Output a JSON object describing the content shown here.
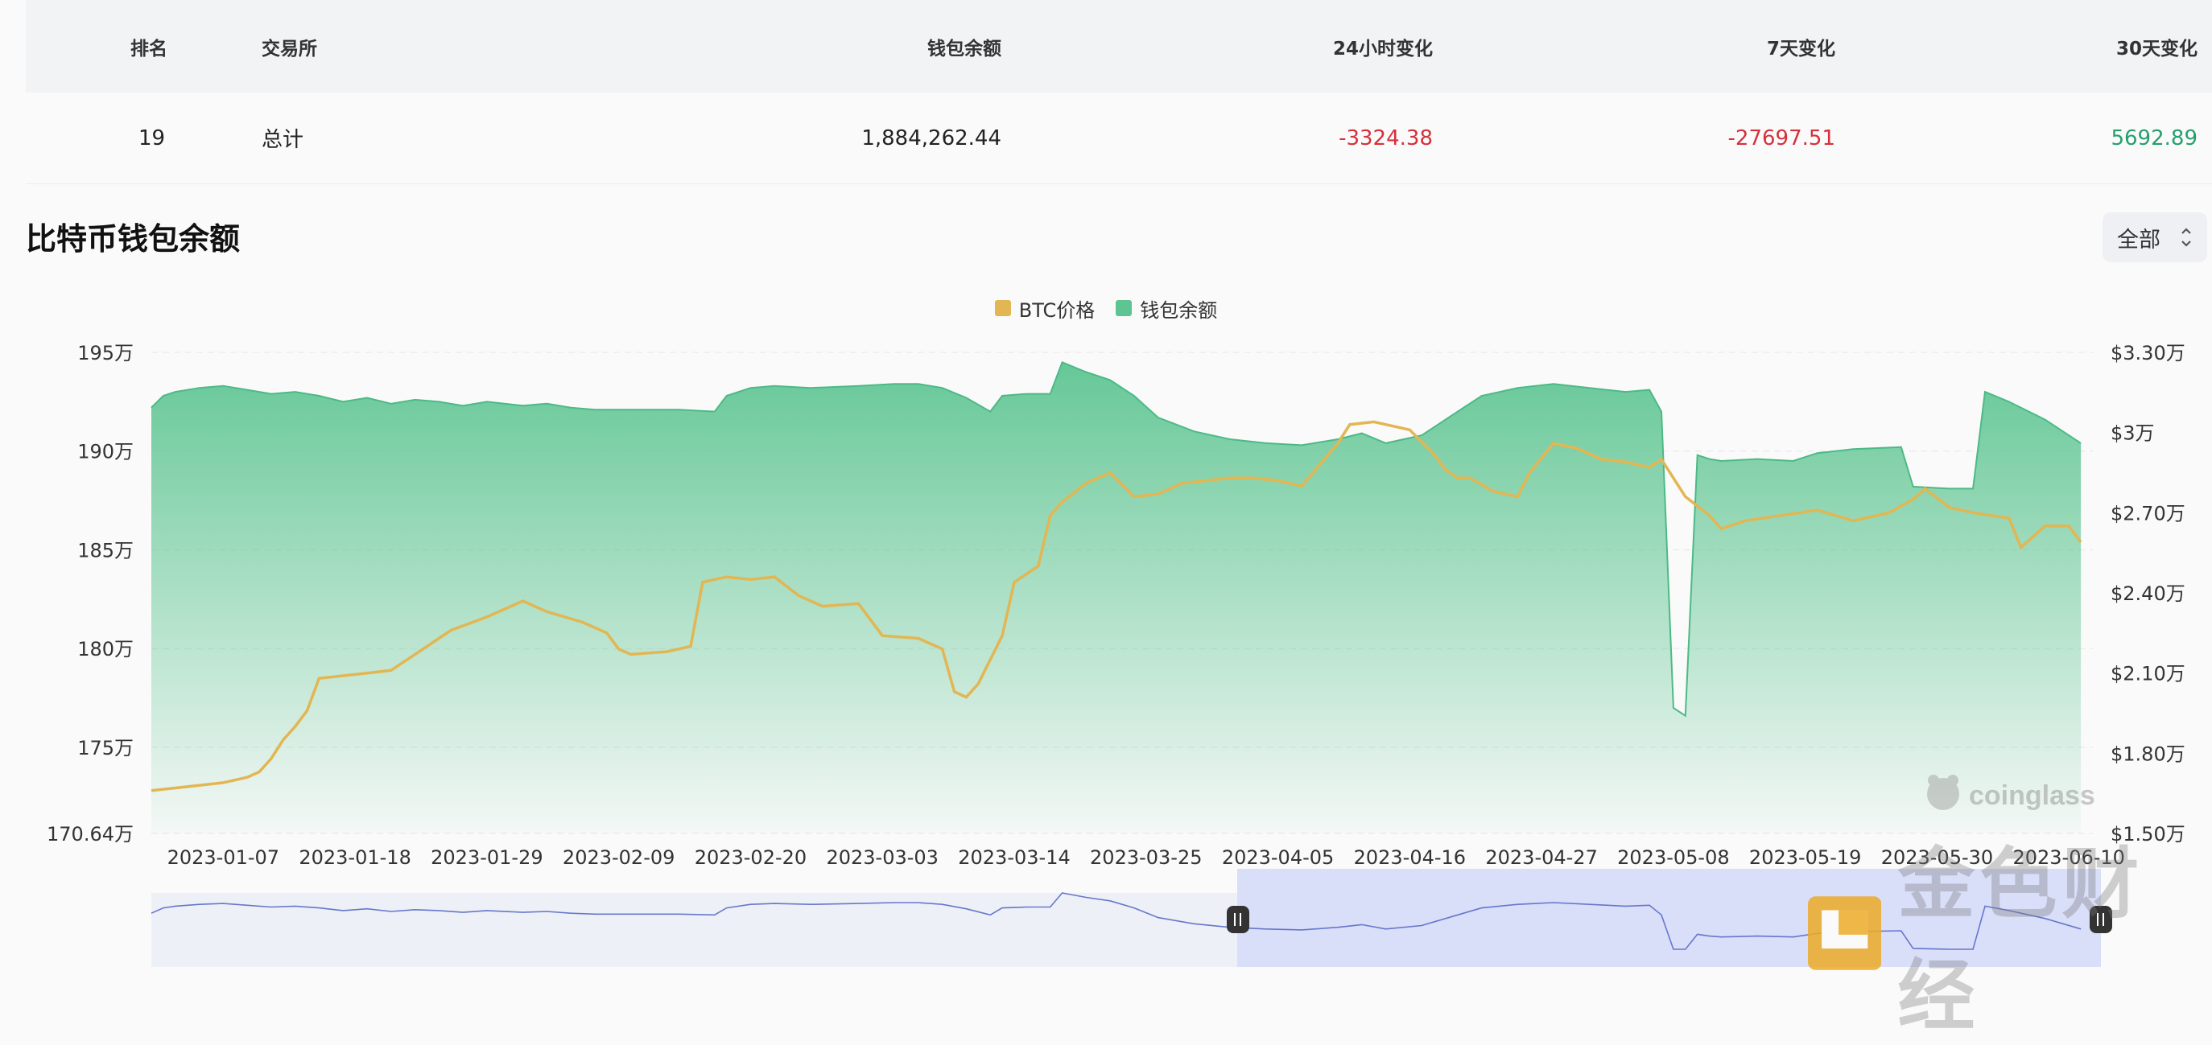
{
  "table": {
    "headers": {
      "rank": "排名",
      "exchange": "交易所",
      "balance": "钱包余额",
      "change_24h": "24小时变化",
      "change_7d": "7天变化",
      "change_30d": "30天变化"
    },
    "row": {
      "rank": "19",
      "exchange": "总计",
      "balance": "1,884,262.44",
      "change_24h": "-3324.38",
      "change_7d": "-27697.51",
      "change_30d": "5692.89"
    }
  },
  "section": {
    "title": "比特币钱包余额",
    "range_select": "全部"
  },
  "colors": {
    "price_line": "#e2b653",
    "balance_fill": "#5ec592",
    "balance_line": "#4cba85",
    "negative": "#d6303b",
    "positive": "#24a06b"
  },
  "watermarks": {
    "coinglass": "coinglass",
    "jinse": "金色财经"
  },
  "chart_data": {
    "type": "area",
    "legend": [
      "BTC价格",
      "钱包余额"
    ],
    "legend_position": "top-center",
    "grid": true,
    "y_left_ticks": [
      "195万",
      "190万",
      "185万",
      "180万",
      "175万",
      "170.64万"
    ],
    "y_right_ticks": [
      "$3.30万",
      "$3万",
      "$2.70万",
      "$2.40万",
      "$2.10万",
      "$1.80万",
      "$1.50万"
    ],
    "x_ticks": [
      "2023-01-07",
      "2023-01-18",
      "2023-01-29",
      "2023-02-09",
      "2023-02-20",
      "2023-03-03",
      "2023-03-14",
      "2023-03-25",
      "2023-04-05",
      "2023-04-16",
      "2023-04-27",
      "2023-05-08",
      "2023-05-19",
      "2023-05-30",
      "2023-06-10"
    ],
    "y_left_range": [
      1706400,
      1950000
    ],
    "y_right_range": [
      15000,
      33000
    ],
    "x_range": [
      "2023-01-01",
      "2023-06-12"
    ],
    "series": [
      {
        "name": "钱包余额",
        "axis": "left",
        "x": [
          "2023-01-01",
          "2023-01-02",
          "2023-01-03",
          "2023-01-05",
          "2023-01-07",
          "2023-01-09",
          "2023-01-11",
          "2023-01-13",
          "2023-01-15",
          "2023-01-17",
          "2023-01-19",
          "2023-01-21",
          "2023-01-23",
          "2023-01-25",
          "2023-01-27",
          "2023-01-29",
          "2023-02-01",
          "2023-02-03",
          "2023-02-05",
          "2023-02-07",
          "2023-02-10",
          "2023-02-14",
          "2023-02-17",
          "2023-02-18",
          "2023-02-20",
          "2023-02-22",
          "2023-02-25",
          "2023-03-01",
          "2023-03-04",
          "2023-03-06",
          "2023-03-08",
          "2023-03-10",
          "2023-03-12",
          "2023-03-13",
          "2023-03-15",
          "2023-03-17",
          "2023-03-18",
          "2023-03-20",
          "2023-03-22",
          "2023-03-24",
          "2023-03-26",
          "2023-03-29",
          "2023-04-01",
          "2023-04-04",
          "2023-04-07",
          "2023-04-10",
          "2023-04-12",
          "2023-04-14",
          "2023-04-17",
          "2023-04-20",
          "2023-04-22",
          "2023-04-25",
          "2023-04-28",
          "2023-05-01",
          "2023-05-04",
          "2023-05-06",
          "2023-05-07",
          "2023-05-08",
          "2023-05-09",
          "2023-05-10",
          "2023-05-11",
          "2023-05-12",
          "2023-05-15",
          "2023-05-18",
          "2023-05-20",
          "2023-05-23",
          "2023-05-27",
          "2023-05-28",
          "2023-05-31",
          "2023-06-02",
          "2023-06-03",
          "2023-06-05",
          "2023-06-08",
          "2023-06-11"
        ],
        "values": [
          1922000,
          1928000,
          1930000,
          1932000,
          1933000,
          1931000,
          1929000,
          1930000,
          1928000,
          1925000,
          1927000,
          1924000,
          1926000,
          1925000,
          1923000,
          1925000,
          1923000,
          1924000,
          1922000,
          1921000,
          1921000,
          1921000,
          1920000,
          1928000,
          1932000,
          1933000,
          1932000,
          1933000,
          1934000,
          1934000,
          1932000,
          1927000,
          1920000,
          1928000,
          1929000,
          1929000,
          1945000,
          1940000,
          1936000,
          1928000,
          1917000,
          1910000,
          1906000,
          1904000,
          1903000,
          1906000,
          1909000,
          1904000,
          1908000,
          1920000,
          1928000,
          1932000,
          1934000,
          1932000,
          1930000,
          1931000,
          1920000,
          1770000,
          1766000,
          1898000,
          1896000,
          1895000,
          1896000,
          1895000,
          1899000,
          1901000,
          1902000,
          1882000,
          1881000,
          1881000,
          1930000,
          1925000,
          1916000,
          1904000
        ]
      },
      {
        "name": "BTC价格",
        "axis": "right",
        "x": [
          "2023-01-01",
          "2023-01-03",
          "2023-01-05",
          "2023-01-07",
          "2023-01-09",
          "2023-01-10",
          "2023-01-11",
          "2023-01-12",
          "2023-01-13",
          "2023-01-14",
          "2023-01-15",
          "2023-01-17",
          "2023-01-19",
          "2023-01-21",
          "2023-01-23",
          "2023-01-26",
          "2023-01-29",
          "2023-02-01",
          "2023-02-03",
          "2023-02-06",
          "2023-02-08",
          "2023-02-09",
          "2023-02-10",
          "2023-02-13",
          "2023-02-15",
          "2023-02-16",
          "2023-02-18",
          "2023-02-20",
          "2023-02-22",
          "2023-02-24",
          "2023-02-26",
          "2023-03-01",
          "2023-03-03",
          "2023-03-06",
          "2023-03-08",
          "2023-03-09",
          "2023-03-10",
          "2023-03-11",
          "2023-03-13",
          "2023-03-14",
          "2023-03-16",
          "2023-03-17",
          "2023-03-18",
          "2023-03-20",
          "2023-03-22",
          "2023-03-24",
          "2023-03-26",
          "2023-03-28",
          "2023-03-30",
          "2023-04-01",
          "2023-04-03",
          "2023-04-05",
          "2023-04-07",
          "2023-04-10",
          "2023-04-11",
          "2023-04-13",
          "2023-04-14",
          "2023-04-16",
          "2023-04-18",
          "2023-04-19",
          "2023-04-20",
          "2023-04-21",
          "2023-04-23",
          "2023-04-25",
          "2023-04-26",
          "2023-04-28",
          "2023-04-30",
          "2023-05-02",
          "2023-05-04",
          "2023-05-06",
          "2023-05-07",
          "2023-05-09",
          "2023-05-11",
          "2023-05-12",
          "2023-05-14",
          "2023-05-17",
          "2023-05-20",
          "2023-05-23",
          "2023-05-26",
          "2023-05-28",
          "2023-05-29",
          "2023-05-31",
          "2023-06-02",
          "2023-06-05",
          "2023-06-06",
          "2023-06-08",
          "2023-06-10",
          "2023-06-11"
        ],
        "values": [
          16600,
          16700,
          16800,
          16900,
          17100,
          17300,
          17800,
          18500,
          19000,
          19600,
          20800,
          20900,
          21000,
          21100,
          21700,
          22600,
          23100,
          23700,
          23300,
          22900,
          22500,
          21900,
          21700,
          21800,
          22000,
          24400,
          24600,
          24500,
          24600,
          23900,
          23500,
          23600,
          22400,
          22300,
          21900,
          20300,
          20100,
          20600,
          22400,
          24400,
          25000,
          26900,
          27400,
          28100,
          28500,
          27600,
          27700,
          28100,
          28200,
          28300,
          28300,
          28200,
          28000,
          29600,
          30300,
          30400,
          30300,
          30100,
          29200,
          28600,
          28300,
          28300,
          27800,
          27600,
          28500,
          29600,
          29400,
          29000,
          28900,
          28700,
          29000,
          27600,
          26900,
          26400,
          26700,
          26900,
          27100,
          26700,
          27000,
          27500,
          27900,
          27200,
          27000,
          26800,
          25700,
          26500,
          26500,
          25900
        ]
      }
    ],
    "annotation_right_scale": "USD"
  }
}
